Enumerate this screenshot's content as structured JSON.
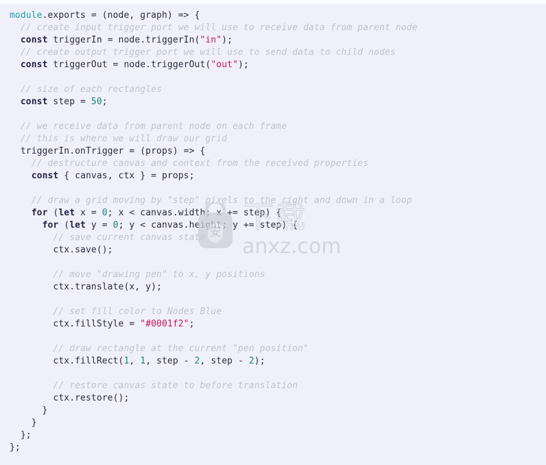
{
  "viewer": {
    "name": "code-snippet-viewer",
    "language": "javascript",
    "background_color": "#f0f0fb",
    "text_color": "#2b2b3d"
  },
  "theme": {
    "keyword_color": "#222244",
    "comment_color": "#c2c2cf",
    "string_color": "#c2185b",
    "number_color": "#14867a",
    "module_color": "#1ba1a8"
  },
  "watermark": {
    "bag_glyph": "安",
    "chinese_text": "下载",
    "domain": "anxz.com"
  },
  "code": {
    "lines": [
      "module.exports = (node, graph) => {",
      "  // create input trigger port we will use to receive data from parent node",
      "  const triggerIn = node.triggerIn(\"in\");",
      "  // create output trigger port we will use to send data to child nodes",
      "  const triggerOut = node.triggerOut(\"out\");",
      "",
      "  // size of each rectangles",
      "  const step = 50;",
      "",
      "  // we receive data from parent node on each frame",
      "  // this is where we will draw our grid",
      "  triggerIn.onTrigger = (props) => {",
      "    // destructure canvas and context from the received properties",
      "    const { canvas, ctx } = props;",
      "",
      "    // draw a grid moving by \"step\" pixels to the right and down in a loop",
      "    for (let x = 0; x < canvas.width; x += step) {",
      "      for (let y = 0; y < canvas.height; y += step) {",
      "        // save current canvas state",
      "        ctx.save();",
      "",
      "        // move \"drawing pen\" to x, y positions",
      "        ctx.translate(x, y);",
      "",
      "        // set fill color to Nodes Blue",
      "        ctx.fillStyle = \"#0001f2\";",
      "",
      "        // draw rectangle at the current \"pen position\"",
      "        ctx.fillRect(1, 1, step - 2, step - 2);",
      "",
      "        // restore canvas state to before translation",
      "        ctx.restore();",
      "      }",
      "    }",
      "  };",
      "};"
    ],
    "tokens": [
      [
        [
          "mod",
          "module"
        ],
        [
          "pln",
          ".exports = (node, graph) => {"
        ]
      ],
      [
        [
          "cmt",
          "  // create input trigger port we will use to receive data from parent node"
        ]
      ],
      [
        [
          "pln",
          "  "
        ],
        [
          "kw",
          "const"
        ],
        [
          "pln",
          " triggerIn = node.triggerIn("
        ],
        [
          "str",
          "\"in\""
        ],
        [
          "pln",
          ");"
        ]
      ],
      [
        [
          "cmt",
          "  // create output trigger port we will use to send data to child nodes"
        ]
      ],
      [
        [
          "pln",
          "  "
        ],
        [
          "kw",
          "const"
        ],
        [
          "pln",
          " triggerOut = node.triggerOut("
        ],
        [
          "str",
          "\"out\""
        ],
        [
          "pln",
          ");"
        ]
      ],
      [
        [
          "pln",
          ""
        ]
      ],
      [
        [
          "cmt",
          "  // size of each rectangles"
        ]
      ],
      [
        [
          "pln",
          "  "
        ],
        [
          "kw",
          "const"
        ],
        [
          "pln",
          " step = "
        ],
        [
          "num",
          "50"
        ],
        [
          "pln",
          ";"
        ]
      ],
      [
        [
          "pln",
          ""
        ]
      ],
      [
        [
          "cmt",
          "  // we receive data from parent node on each frame"
        ]
      ],
      [
        [
          "cmt",
          "  // this is where we will draw our grid"
        ]
      ],
      [
        [
          "pln",
          "  triggerIn.onTrigger = (props) => {"
        ]
      ],
      [
        [
          "cmt",
          "    // destructure canvas and context from the received properties"
        ]
      ],
      [
        [
          "pln",
          "    "
        ],
        [
          "kw",
          "const"
        ],
        [
          "pln",
          " { canvas, ctx } = props;"
        ]
      ],
      [
        [
          "pln",
          ""
        ]
      ],
      [
        [
          "cmt",
          "    // draw a grid moving by \"step\" pixels to the right and down in a loop"
        ]
      ],
      [
        [
          "pln",
          "    "
        ],
        [
          "kw",
          "for"
        ],
        [
          "pln",
          " ("
        ],
        [
          "kw",
          "let"
        ],
        [
          "pln",
          " x = "
        ],
        [
          "num",
          "0"
        ],
        [
          "pln",
          "; x < canvas.width; x += step) {"
        ]
      ],
      [
        [
          "pln",
          "      "
        ],
        [
          "kw",
          "for"
        ],
        [
          "pln",
          " ("
        ],
        [
          "kw",
          "let"
        ],
        [
          "pln",
          " y = "
        ],
        [
          "num",
          "0"
        ],
        [
          "pln",
          "; y < canvas.height; y += step) {"
        ]
      ],
      [
        [
          "cmt",
          "        // save current canvas state"
        ]
      ],
      [
        [
          "pln",
          "        ctx.save();"
        ]
      ],
      [
        [
          "pln",
          ""
        ]
      ],
      [
        [
          "cmt",
          "        // move \"drawing pen\" to x, y positions"
        ]
      ],
      [
        [
          "pln",
          "        ctx.translate(x, y);"
        ]
      ],
      [
        [
          "pln",
          ""
        ]
      ],
      [
        [
          "cmt",
          "        // set fill color to Nodes Blue"
        ]
      ],
      [
        [
          "pln",
          "        ctx.fillStyle = "
        ],
        [
          "str",
          "\"#0001f2\""
        ],
        [
          "pln",
          ";"
        ]
      ],
      [
        [
          "pln",
          ""
        ]
      ],
      [
        [
          "cmt",
          "        // draw rectangle at the current \"pen position\""
        ]
      ],
      [
        [
          "pln",
          "        ctx.fillRect("
        ],
        [
          "num",
          "1"
        ],
        [
          "pln",
          ", "
        ],
        [
          "num",
          "1"
        ],
        [
          "pln",
          ", step - "
        ],
        [
          "num",
          "2"
        ],
        [
          "pln",
          ", step - "
        ],
        [
          "num",
          "2"
        ],
        [
          "pln",
          ");"
        ]
      ],
      [
        [
          "pln",
          ""
        ]
      ],
      [
        [
          "cmt",
          "        // restore canvas state to before translation"
        ]
      ],
      [
        [
          "pln",
          "        ctx.restore();"
        ]
      ],
      [
        [
          "pln",
          "      }"
        ]
      ],
      [
        [
          "pln",
          "    }"
        ]
      ],
      [
        [
          "pln",
          "  };"
        ]
      ],
      [
        [
          "pln",
          "};"
        ]
      ]
    ]
  }
}
